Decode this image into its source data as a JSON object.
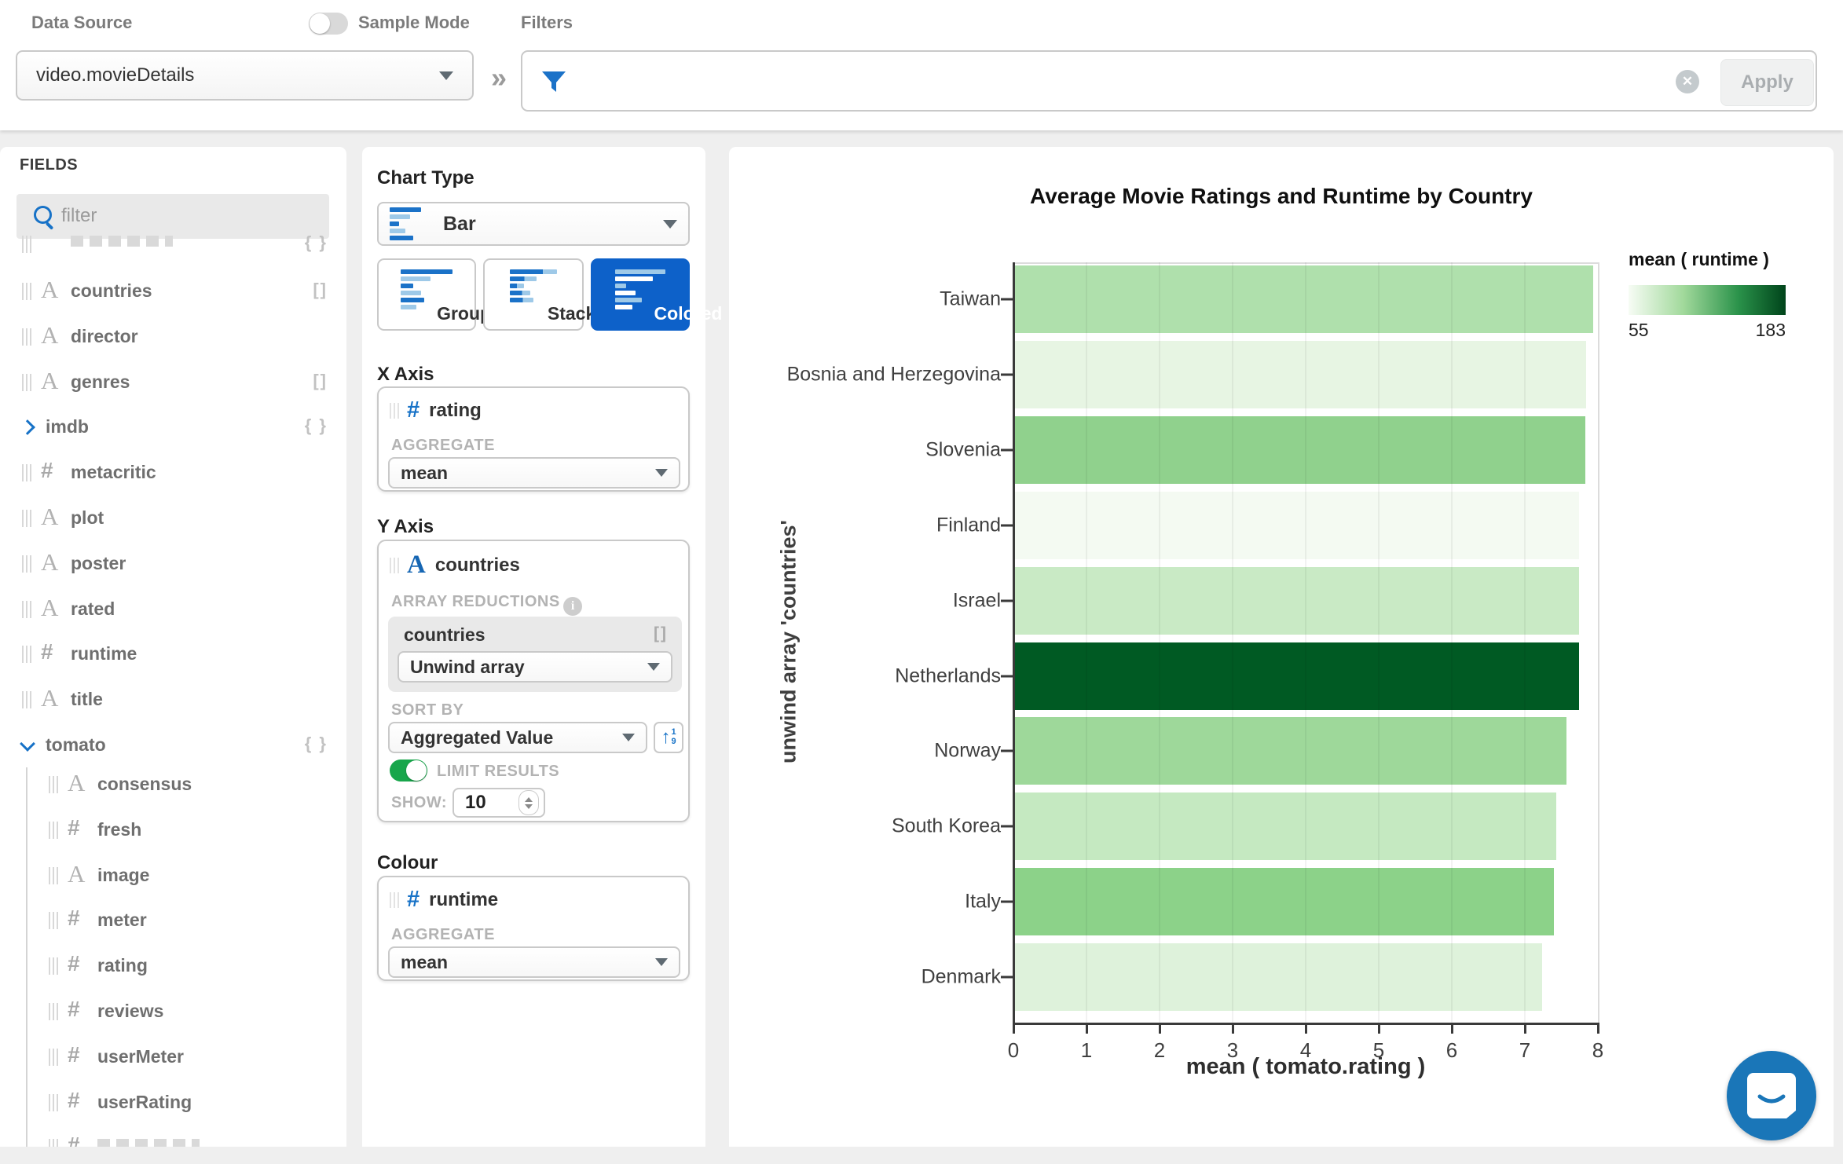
{
  "topbar": {
    "data_source_label": "Data Source",
    "data_source_value": "video.movieDetails",
    "sample_mode_label": "Sample Mode",
    "sample_mode_on": false,
    "filters_label": "Filters",
    "apply_label": "Apply",
    "collapse_chevrons": "»"
  },
  "fields_panel": {
    "title": "FIELDS",
    "filter_placeholder": "filter",
    "items": [
      {
        "label": "",
        "icon": "object",
        "badge": "{ }",
        "partial": "top"
      },
      {
        "label": "countries",
        "icon": "string",
        "badge": "[]"
      },
      {
        "label": "director",
        "icon": "string"
      },
      {
        "label": "genres",
        "icon": "string",
        "badge": "[]"
      },
      {
        "label": "imdb",
        "icon": "object",
        "badge": "{ }",
        "expandable": true,
        "expanded": false
      },
      {
        "label": "metacritic",
        "icon": "number"
      },
      {
        "label": "plot",
        "icon": "string"
      },
      {
        "label": "poster",
        "icon": "string"
      },
      {
        "label": "rated",
        "icon": "string"
      },
      {
        "label": "runtime",
        "icon": "number"
      },
      {
        "label": "title",
        "icon": "string"
      },
      {
        "label": "tomato",
        "icon": "object",
        "badge": "{ }",
        "expandable": true,
        "expanded": true
      },
      {
        "label": "consensus",
        "icon": "string",
        "child": true
      },
      {
        "label": "fresh",
        "icon": "number",
        "child": true
      },
      {
        "label": "image",
        "icon": "string",
        "child": true
      },
      {
        "label": "meter",
        "icon": "number",
        "child": true
      },
      {
        "label": "rating",
        "icon": "number",
        "child": true
      },
      {
        "label": "reviews",
        "icon": "number",
        "child": true
      },
      {
        "label": "userMeter",
        "icon": "number",
        "child": true
      },
      {
        "label": "userRating",
        "icon": "number",
        "child": true
      },
      {
        "label": "",
        "icon": "number",
        "child": true,
        "partial": "bottom"
      }
    ]
  },
  "builder": {
    "chart_type_label": "Chart Type",
    "chart_type_value": "Bar",
    "modes": [
      "Grouped",
      "Stacked",
      "Colored"
    ],
    "selected_mode": "Colored",
    "x_axis": {
      "heading": "X Axis",
      "field": "rating",
      "field_type": "number",
      "aggregate_label": "AGGREGATE",
      "aggregate_value": "mean"
    },
    "y_axis": {
      "heading": "Y Axis",
      "field": "countries",
      "field_type": "string",
      "array_reductions_label": "ARRAY REDUCTIONS",
      "reduction_field": "countries",
      "reduction_badge": "[]",
      "reduction_value": "Unwind array",
      "sort_by_label": "SORT BY",
      "sort_by_value": "Aggregated Value",
      "limit_results_label": "LIMIT RESULTS",
      "limit_results_on": true,
      "show_label": "SHOW:",
      "show_value": "10"
    },
    "colour": {
      "heading": "Colour",
      "field": "runtime",
      "field_type": "number",
      "aggregate_label": "AGGREGATE",
      "aggregate_value": "mean"
    }
  },
  "chart_data": {
    "type": "bar",
    "orientation": "horizontal",
    "title": "Average Movie Ratings and Runtime by Country",
    "xlabel": "mean ( tomato.rating )",
    "ylabel": "unwind array 'countries'",
    "xlim": [
      0,
      8
    ],
    "xticks": [
      0,
      1,
      2,
      3,
      4,
      5,
      6,
      7,
      8
    ],
    "grid": true,
    "categories": [
      "Taiwan",
      "Bosnia and Herzegovina",
      "Slovenia",
      "Finland",
      "Israel",
      "Netherlands",
      "Norway",
      "South Korea",
      "Italy",
      "Denmark"
    ],
    "values": [
      7.91,
      7.82,
      7.81,
      7.72,
      7.72,
      7.72,
      7.55,
      7.41,
      7.38,
      7.22
    ],
    "bar_colors": [
      "#afe0ac",
      "#e7f5e3",
      "#90d18d",
      "#f4faf2",
      "#c9eac5",
      "#005a23",
      "#9ed89a",
      "#c5e9c1",
      "#8cd289",
      "#def2db"
    ],
    "legend": {
      "title": "mean ( runtime )",
      "min": 55,
      "max": 183,
      "position": "top-right",
      "gradient": [
        "#f7fcf5",
        "#a1d99b",
        "#2a924a",
        "#00441b"
      ]
    }
  },
  "misc": {
    "intercom_color": "#1a76b8",
    "accent_blue": "#1772c7",
    "selected_blue": "#0d61c9",
    "toggle_green": "#18a64b"
  }
}
